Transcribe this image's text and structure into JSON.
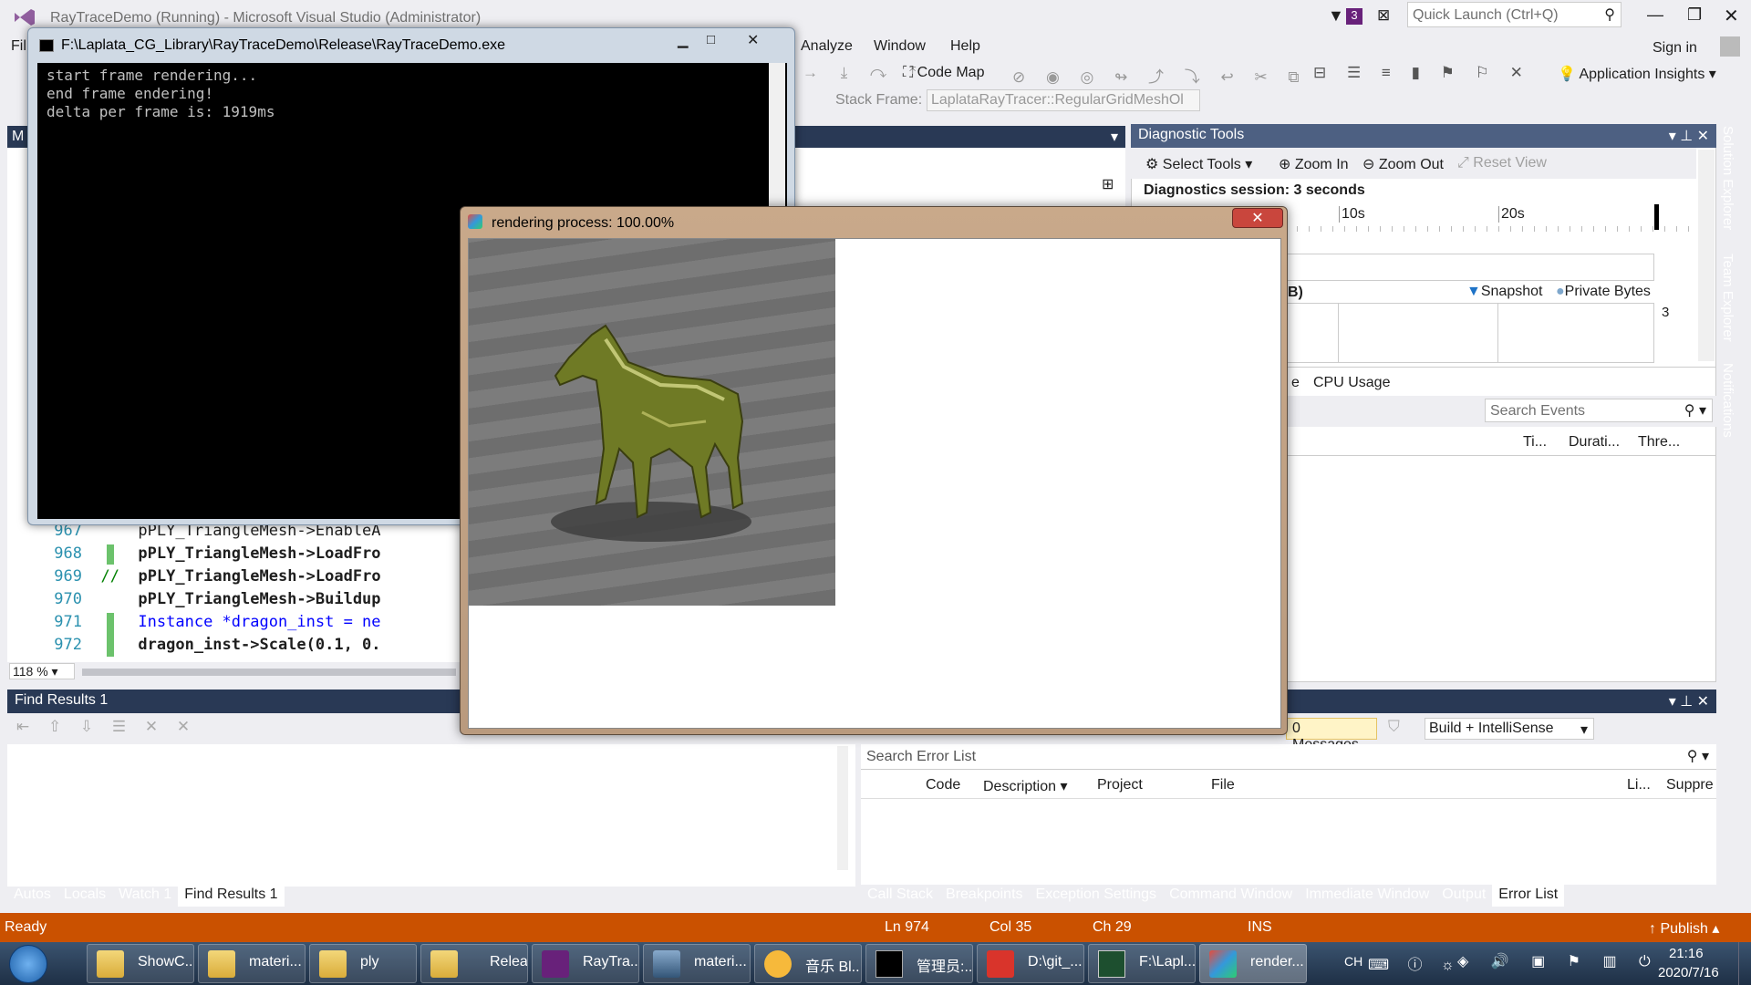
{
  "vs": {
    "title": "RayTraceDemo (Running) - Microsoft Visual Studio (Administrator)",
    "notifications_count": "3",
    "quick_launch_placeholder": "Quick Launch (Ctrl+Q)",
    "sign_in": "Sign in",
    "menu": {
      "file_partial": "Fil",
      "analyze": "Analyze",
      "window": "Window",
      "help": "Help"
    },
    "toolbar": {
      "code_map": "Code Map",
      "application_insights": "Application Insights",
      "stack_frame_label": "Stack Frame:",
      "stack_frame_value": "LaplataRayTracer::RegularGridMeshOl"
    },
    "editor": {
      "tab_partial": "M",
      "zoom": "118 %",
      "lines": [
        {
          "num": "967",
          "text": "pPLY_TriangleMesh->EnableA",
          "comment": false,
          "changed": false
        },
        {
          "num": "968",
          "text": "pPLY_TriangleMesh->LoadFro",
          "comment": false,
          "changed": true
        },
        {
          "num": "969",
          "text": "pPLY_TriangleMesh->LoadFro",
          "comment": true,
          "changed": false
        },
        {
          "num": "970",
          "text": "pPLY_TriangleMesh->Buildup",
          "comment": false,
          "changed": false
        },
        {
          "num": "971",
          "text": "Instance *dragon_inst = ne",
          "comment": false,
          "changed": true
        },
        {
          "num": "972",
          "text": "dragon_inst->Scale(0.1, 0.",
          "comment": false,
          "changed": true
        }
      ],
      "comment_marker": "//"
    },
    "diagnostic": {
      "title": "Diagnostic Tools",
      "select_tools": "Select Tools",
      "zoom_in": "Zoom In",
      "zoom_out": "Zoom Out",
      "reset_view": "Reset View",
      "session": "Diagnostics session: 3 seconds",
      "tick_10": "10s",
      "tick_20": "20s",
      "mem_label_partial": "B)",
      "snapshot": "Snapshot",
      "private_bytes": "Private Bytes",
      "mem_value": "3",
      "tab_partial": "e",
      "cpu_usage": "CPU Usage",
      "search_events": "Search Events",
      "col_time": "Ti...",
      "col_duration": "Durati...",
      "col_thread": "Thre..."
    },
    "find_results": {
      "title": "Find Results 1"
    },
    "bottom_left_tabs": [
      "Autos",
      "Locals",
      "Watch 1",
      "Find Results 1"
    ],
    "bottom_left_active": "Find Results 1",
    "error_list": {
      "messages": "0 Messages",
      "build_filter": "Build + IntelliSense",
      "search": "Search Error List",
      "col_code": "Code",
      "col_description": "Description",
      "col_project": "Project",
      "col_file": "File",
      "col_line": "Li...",
      "col_suppress": "Suppre"
    },
    "bottom_right_tabs": [
      "Call Stack",
      "Breakpoints",
      "Exception Settings",
      "Command Window",
      "Immediate Window",
      "Output",
      "Error List"
    ],
    "bottom_right_active": "Error List",
    "side_tabs": [
      "Solution Explorer",
      "Team Explorer",
      "Notifications"
    ],
    "status": {
      "ready": "Ready",
      "ln": "Ln 974",
      "col": "Col 35",
      "ch": "Ch 29",
      "ins": "INS",
      "publish": "Publish"
    }
  },
  "console": {
    "title": "F:\\Laplata_CG_Library\\RayTraceDemo\\Release\\RayTraceDemo.exe",
    "output": "start frame rendering...\nend frame endering!\ndelta per frame is: 1919ms"
  },
  "render_window": {
    "title": "rendering process: 100.00%"
  },
  "taskbar": {
    "items": [
      "ShowC...",
      "materi...",
      "ply",
      "Release",
      "RayTra...",
      "materi...",
      "音乐 Bl...",
      "管理员:...",
      "D:\\git_...",
      "F:\\Lapl...",
      "render..."
    ],
    "tray_ch": "CH",
    "time": "21:16",
    "date": "2020/7/16"
  },
  "colors": {
    "vs_accent": "#293955",
    "status_bar": "#CA5100",
    "console_bg": "#000000"
  }
}
